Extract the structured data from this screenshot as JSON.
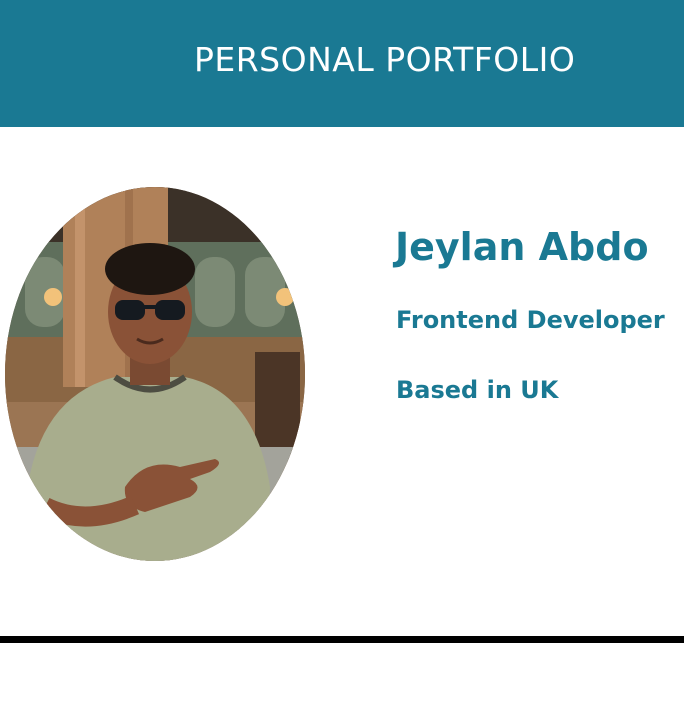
{
  "header": {
    "title": "PERSONAL PORTFOLIO"
  },
  "profile": {
    "name": "Jeylan Abdo",
    "role": "Frontend Developer",
    "location": "Based in UK"
  },
  "colors": {
    "accent": "#1a7993",
    "background": "#ffffff",
    "divider": "#000000"
  }
}
